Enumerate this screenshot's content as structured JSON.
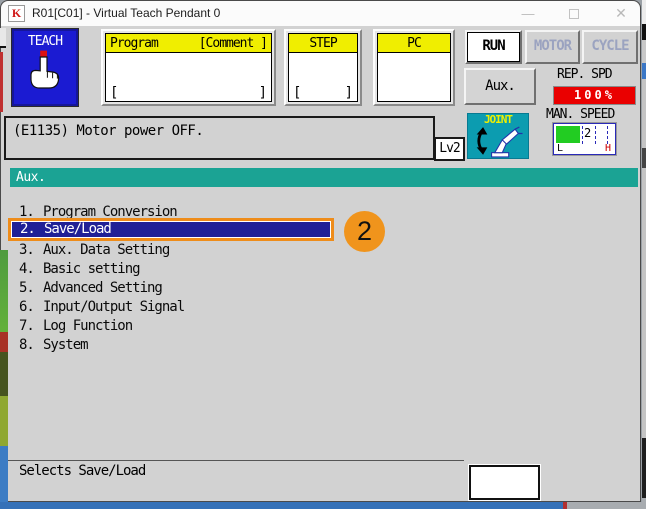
{
  "window": {
    "icon_letter": "K",
    "title": "R01[C01] - Virtual Teach Pendant 0",
    "minimize_glyph": "—",
    "close_glyph": "✕"
  },
  "toolbar": {
    "teach": "TEACH",
    "program_header": "Program",
    "comment_header": "[Comment ]",
    "step_header": "STEP",
    "pc_header": "PC",
    "open_bracket": "[",
    "close_bracket": "]",
    "run": "RUN",
    "motor": "MOTOR",
    "cycle": "CYCLE",
    "aux": "Aux.",
    "rep_spd_label": "REP. SPD",
    "rep_spd_value": "100%",
    "man_speed_label": "MAN. SPEED",
    "man_speed_value": "2",
    "man_speed_min": "L",
    "man_speed_max": "H",
    "interp_label": "JOINT",
    "error_level": "Lv2"
  },
  "message_bar": {
    "text": "(E1135) Motor power OFF."
  },
  "menu": {
    "title": "Aux.",
    "items": [
      {
        "number": "1.",
        "label": "Program Conversion",
        "selected": false
      },
      {
        "number": "2.",
        "label": "Save/Load",
        "selected": true
      },
      {
        "number": "3.",
        "label": "Aux. Data Setting",
        "selected": false
      },
      {
        "number": "4.",
        "label": "Basic setting",
        "selected": false
      },
      {
        "number": "5.",
        "label": "Advanced Setting",
        "selected": false
      },
      {
        "number": "6.",
        "label": "Input/Output Signal",
        "selected": false
      },
      {
        "number": "7.",
        "label": "Log Function",
        "selected": false
      },
      {
        "number": "8.",
        "label": "System",
        "selected": false
      }
    ]
  },
  "annotation": {
    "step_badge": "2"
  },
  "status_bar": {
    "prompt": "Selects Save/Load",
    "input_value": ""
  },
  "colors": {
    "teach_blue": "#1b1bd2",
    "header_yellow": "#f0ee00",
    "speed_red": "#ea0000",
    "gauge_green": "#22cc22",
    "menu_teal": "#1ba394",
    "highlight_navy": "#202096",
    "annotation_orange": "#f0941c",
    "joint_teal": "#0c9cb0"
  }
}
